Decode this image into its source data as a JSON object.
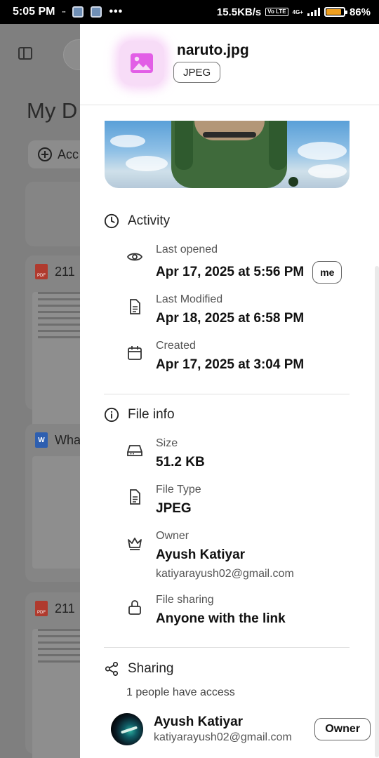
{
  "status_bar": {
    "time": "5:05 PM",
    "network_speed": "15.5KB/s",
    "network_type": "4G+",
    "volte": "Vo LTE",
    "battery_percent": "86%",
    "battery_level": 0.86
  },
  "background": {
    "page_title": "My D",
    "add_button_label": "Acc",
    "cards": [
      {
        "type_icon": "pdf-icon",
        "title": "211"
      },
      {
        "type_icon": "word-icon",
        "title": "Wha"
      },
      {
        "type_icon": "pdf-icon",
        "title": "211"
      }
    ]
  },
  "details": {
    "file_name": "naruto.jpg",
    "file_type_chip": "JPEG",
    "file_icon": "image-icon",
    "activity": {
      "heading": "Activity",
      "items": [
        {
          "icon": "eye-icon",
          "label": "Last opened",
          "value": "Apr 17, 2025 at 5:56 PM",
          "chip": "me"
        },
        {
          "icon": "document-icon",
          "label": "Last Modified",
          "value": "Apr 18, 2025 at 6:58 PM"
        },
        {
          "icon": "calendar-icon",
          "label": "Created",
          "value": "Apr 17, 2025 at 3:04 PM"
        }
      ]
    },
    "file_info": {
      "heading": "File info",
      "size_label": "Size",
      "size_value": "51.2 KB",
      "type_label": "File Type",
      "type_value": "JPEG",
      "owner_label": "Owner",
      "owner_name": "Ayush Katiyar",
      "owner_email": "katiyarayush02@gmail.com",
      "sharing_label": "File sharing",
      "sharing_value": "Anyone with the link"
    },
    "sharing": {
      "heading": "Sharing",
      "summary": "1 people have access",
      "members": [
        {
          "name": "Ayush Katiyar",
          "email": "katiyarayush02@gmail.com",
          "role": "Owner"
        }
      ]
    }
  }
}
